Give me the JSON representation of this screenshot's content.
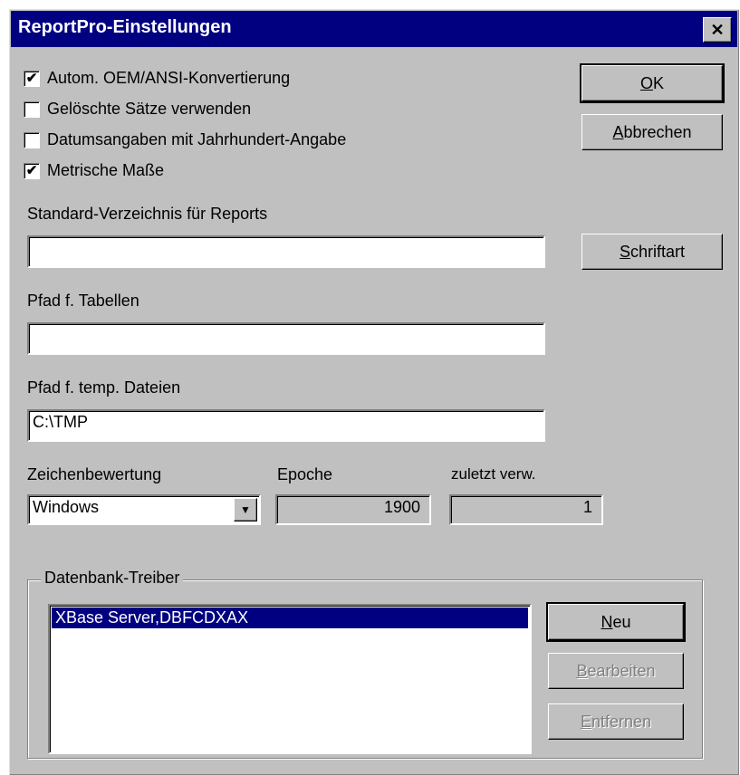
{
  "window": {
    "title": "ReportPro-Einstellungen",
    "close_glyph": "✕"
  },
  "options": [
    {
      "label": "Autom. OEM/ANSI-Konvertierung",
      "checked": true,
      "mark": "✔"
    },
    {
      "label": "Gelöschte Sätze verwenden",
      "checked": false,
      "mark": ""
    },
    {
      "label": "Datumsangaben mit Jahrhundert-Angabe",
      "checked": false,
      "mark": ""
    },
    {
      "label": "Metrische Maße",
      "checked": true,
      "mark": "✔"
    }
  ],
  "buttons": {
    "ok": {
      "mnemonic": "O",
      "rest": "K"
    },
    "cancel": {
      "mnemonic": "A",
      "rest": "bbrechen"
    },
    "font": {
      "mnemonic": "S",
      "rest": "chriftart"
    },
    "new": {
      "mnemonic": "N",
      "rest": "eu"
    },
    "edit": {
      "mnemonic": "B",
      "rest": "earbeiten"
    },
    "remove": {
      "mnemonic": "E",
      "rest": "ntfernen"
    }
  },
  "fields": {
    "report_dir": {
      "label": "Standard-Verzeichnis für Reports",
      "value": ""
    },
    "table_path": {
      "label": "Pfad f. Tabellen",
      "value": ""
    },
    "temp_path": {
      "label": "Pfad f. temp. Dateien",
      "value": "C:\\TMP"
    }
  },
  "charset": {
    "label": "Zeichenbewertung",
    "value": "Windows",
    "arrow": "▼"
  },
  "epoch": {
    "label": "Epoche",
    "value": "1900"
  },
  "last_used": {
    "label": "zuletzt verw.",
    "value": "1"
  },
  "drivers": {
    "group_label": "Datenbank-Treiber",
    "items": [
      "XBase Server,DBFCDXAX"
    ]
  },
  "colors": {
    "face": "#c0c0c0",
    "title_bar": "#000080",
    "selection": "#000080"
  }
}
